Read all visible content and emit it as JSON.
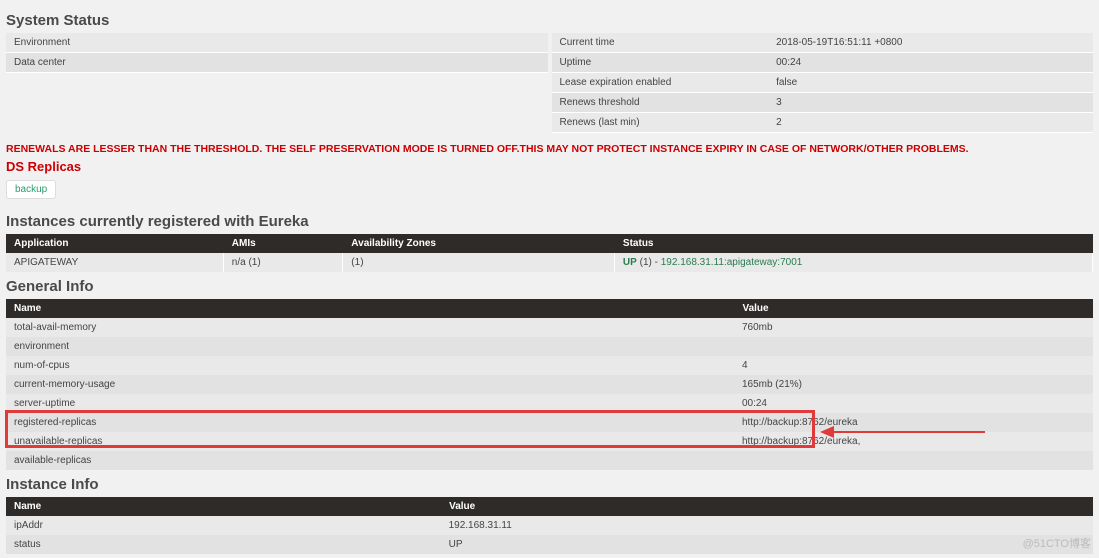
{
  "systemStatus": {
    "title": "System Status",
    "left": [
      {
        "label": "Environment",
        "value": ""
      },
      {
        "label": "Data center",
        "value": ""
      }
    ],
    "right": [
      {
        "label": "Current time",
        "value": "2018-05-19T16:51:11 +0800"
      },
      {
        "label": "Uptime",
        "value": "00:24"
      },
      {
        "label": "Lease expiration enabled",
        "value": "false"
      },
      {
        "label": "Renews threshold",
        "value": "3"
      },
      {
        "label": "Renews (last min)",
        "value": "2"
      }
    ]
  },
  "warningText": "RENEWALS ARE LESSER THAN THE THRESHOLD. THE SELF PRESERVATION MODE IS TURNED OFF.THIS MAY NOT PROTECT INSTANCE EXPIRY IN CASE OF NETWORK/OTHER PROBLEMS.",
  "dsReplicas": {
    "title": "DS Replicas",
    "items": [
      "backup"
    ]
  },
  "instances": {
    "title": "Instances currently registered with Eureka",
    "headers": [
      "Application",
      "AMIs",
      "Availability Zones",
      "Status"
    ],
    "rows": [
      {
        "application": "APIGATEWAY",
        "amis": "n/a (1)",
        "zones": "(1)",
        "statusLabel": "UP",
        "statusCount": "(1)",
        "statusSep": " - ",
        "statusLink": "192.168.31.11:apigateway:7001"
      }
    ]
  },
  "generalInfo": {
    "title": "General Info",
    "headers": [
      "Name",
      "Value"
    ],
    "rows": [
      {
        "name": "total-avail-memory",
        "value": "760mb"
      },
      {
        "name": "environment",
        "value": ""
      },
      {
        "name": "num-of-cpus",
        "value": "4"
      },
      {
        "name": "current-memory-usage",
        "value": "165mb (21%)"
      },
      {
        "name": "server-uptime",
        "value": "00:24"
      },
      {
        "name": "registered-replicas",
        "value": "http://backup:8762/eureka"
      },
      {
        "name": "unavailable-replicas",
        "value": "http://backup:8762/eureka,"
      },
      {
        "name": "available-replicas",
        "value": ""
      }
    ]
  },
  "instanceInfo": {
    "title": "Instance Info",
    "headers": [
      "Name",
      "Value"
    ],
    "rows": [
      {
        "name": "ipAddr",
        "value": "192.168.31.11"
      },
      {
        "name": "status",
        "value": "UP"
      }
    ]
  },
  "watermark": "@51CTO博客"
}
